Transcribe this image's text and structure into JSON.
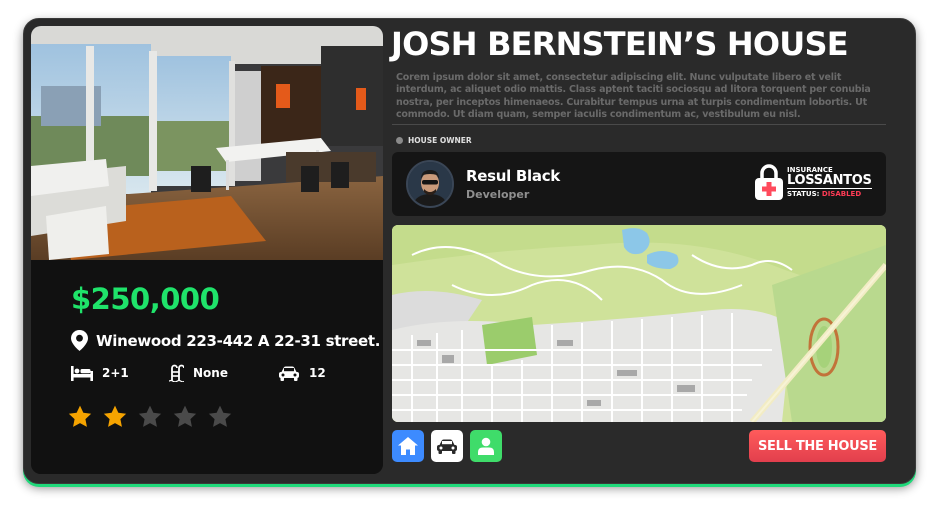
{
  "house": {
    "title": "JOSH BERNSTEIN’S HOUSE",
    "description": "Corem ipsum dolor sit amet, consectetur adipiscing elit. Nunc vulputate libero et velit interdum, ac aliquet odio mattis. Class aptent taciti sociosqu ad litora torquent per conubia nostra, per inceptos himenaeos. Curabitur tempus urna at turpis condimentum lobortis. Ut commodo. Ut diam quam, semper iaculis condimentum ac, vestibulum eu nisl.",
    "price": "$250,000",
    "address": "Winewood 223-442 A 22-31 street.",
    "bedrooms": "2+1",
    "pool": "None",
    "garage": "12",
    "rating": 2,
    "rating_max": 5
  },
  "owner": {
    "section_label": "HOUSE OWNER",
    "name": "Resul Black",
    "role": "Developer"
  },
  "insurance": {
    "label": "INSURANCE",
    "company": "LOSSANTOS",
    "status_label": "STATUS:",
    "status_value": "DISABLED"
  },
  "actions": {
    "sell_label": "SELL THE HOUSE"
  },
  "icons": {
    "pin": "map-pin-icon",
    "bed": "bed-icon",
    "pool": "pool-ladder-icon",
    "car": "car-icon",
    "lock": "lock-icon",
    "home_tab": "home-icon",
    "garage_tab": "car-icon",
    "owner_tab": "user-icon"
  },
  "colors": {
    "price": "#1fe36a",
    "accent_border": "#1fd97a",
    "star_on": "#f5a300",
    "star_off": "#4a4a4a",
    "sell": "#ff5b5b",
    "home_tab": "#3d8bff",
    "garage_tab": "#ffffff",
    "owner_tab": "#3fdc6a",
    "disabled": "#ff3b55"
  }
}
